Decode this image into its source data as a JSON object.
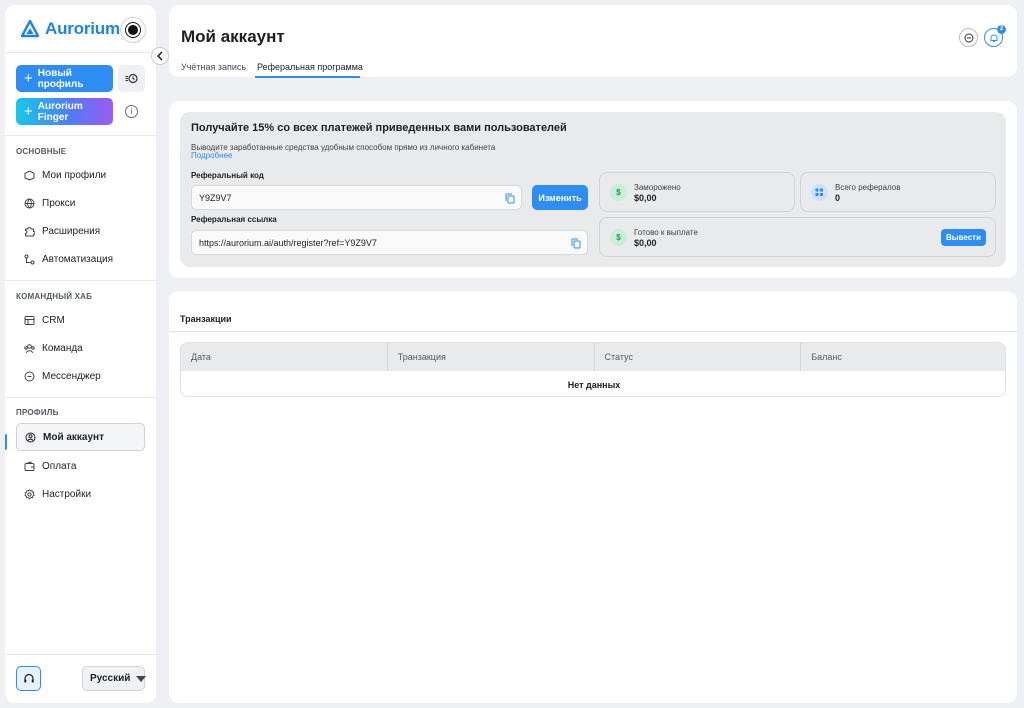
{
  "app": {
    "name": "Aurorium",
    "colors": {
      "accent": "#2e8df2",
      "finger_gradient": [
        "#16c8ea",
        "#4f7cf5",
        "#9b5cf2"
      ],
      "green": "#1a9a4e"
    }
  },
  "sidebar": {
    "new_profile": "Новый профиль",
    "finger": "Aurorium Finger",
    "info_glyph": "i",
    "sections": [
      {
        "title": "ОСНОВНЫЕ",
        "items": [
          {
            "label": "Мои профили",
            "icon": "cube-icon"
          },
          {
            "label": "Прокси",
            "icon": "globe-icon"
          },
          {
            "label": "Расширения",
            "icon": "puzzle-icon"
          },
          {
            "label": "Автоматизация",
            "icon": "flow-icon"
          }
        ]
      },
      {
        "title": "КОМАНДНЫЙ ХАБ",
        "items": [
          {
            "label": "CRM",
            "icon": "crm-icon"
          },
          {
            "label": "Команда",
            "icon": "team-icon"
          },
          {
            "label": "Мессенджер",
            "icon": "chat-icon"
          }
        ]
      },
      {
        "title": "ПРОФИЛЬ",
        "items": [
          {
            "label": "Мой аккаунт",
            "icon": "user-icon",
            "active": true
          },
          {
            "label": "Оплата",
            "icon": "wallet-icon"
          },
          {
            "label": "Настройки",
            "icon": "gear-icon"
          }
        ]
      }
    ],
    "language": "Русский"
  },
  "header": {
    "title": "Мой аккаунт",
    "tabs": [
      {
        "label": "Учётная запись",
        "active": false
      },
      {
        "label": "Реферальная программа",
        "active": true
      }
    ],
    "notifications_count": "2"
  },
  "referral": {
    "headline": "Получайте 15% со всех платежей приведенных вами пользователей",
    "subtitle": "Выводите заработанные средства удобным способом прямо из личного кабинета",
    "more_link": "Подробнее",
    "code_label": "Реферальный код",
    "code_value": "Y9Z9V7",
    "change_button": "Изменить",
    "link_label": "Реферальная ссылка",
    "link_value": "https://aurorium.ai/auth/register?ref=Y9Z9V7",
    "currency_glyph": "$",
    "stats": {
      "frozen": {
        "label": "Заморожено",
        "value": "$0,00"
      },
      "total_referrals": {
        "label": "Всего рефералов",
        "value": "0"
      },
      "ready": {
        "label": "Готово к выплате",
        "value": "$0,00",
        "button": "Вывести"
      }
    }
  },
  "transactions": {
    "title": "Транзакции",
    "columns": [
      "Дата",
      "Транзакция",
      "Статус",
      "Баланс"
    ],
    "empty_text": "Нет данных"
  }
}
